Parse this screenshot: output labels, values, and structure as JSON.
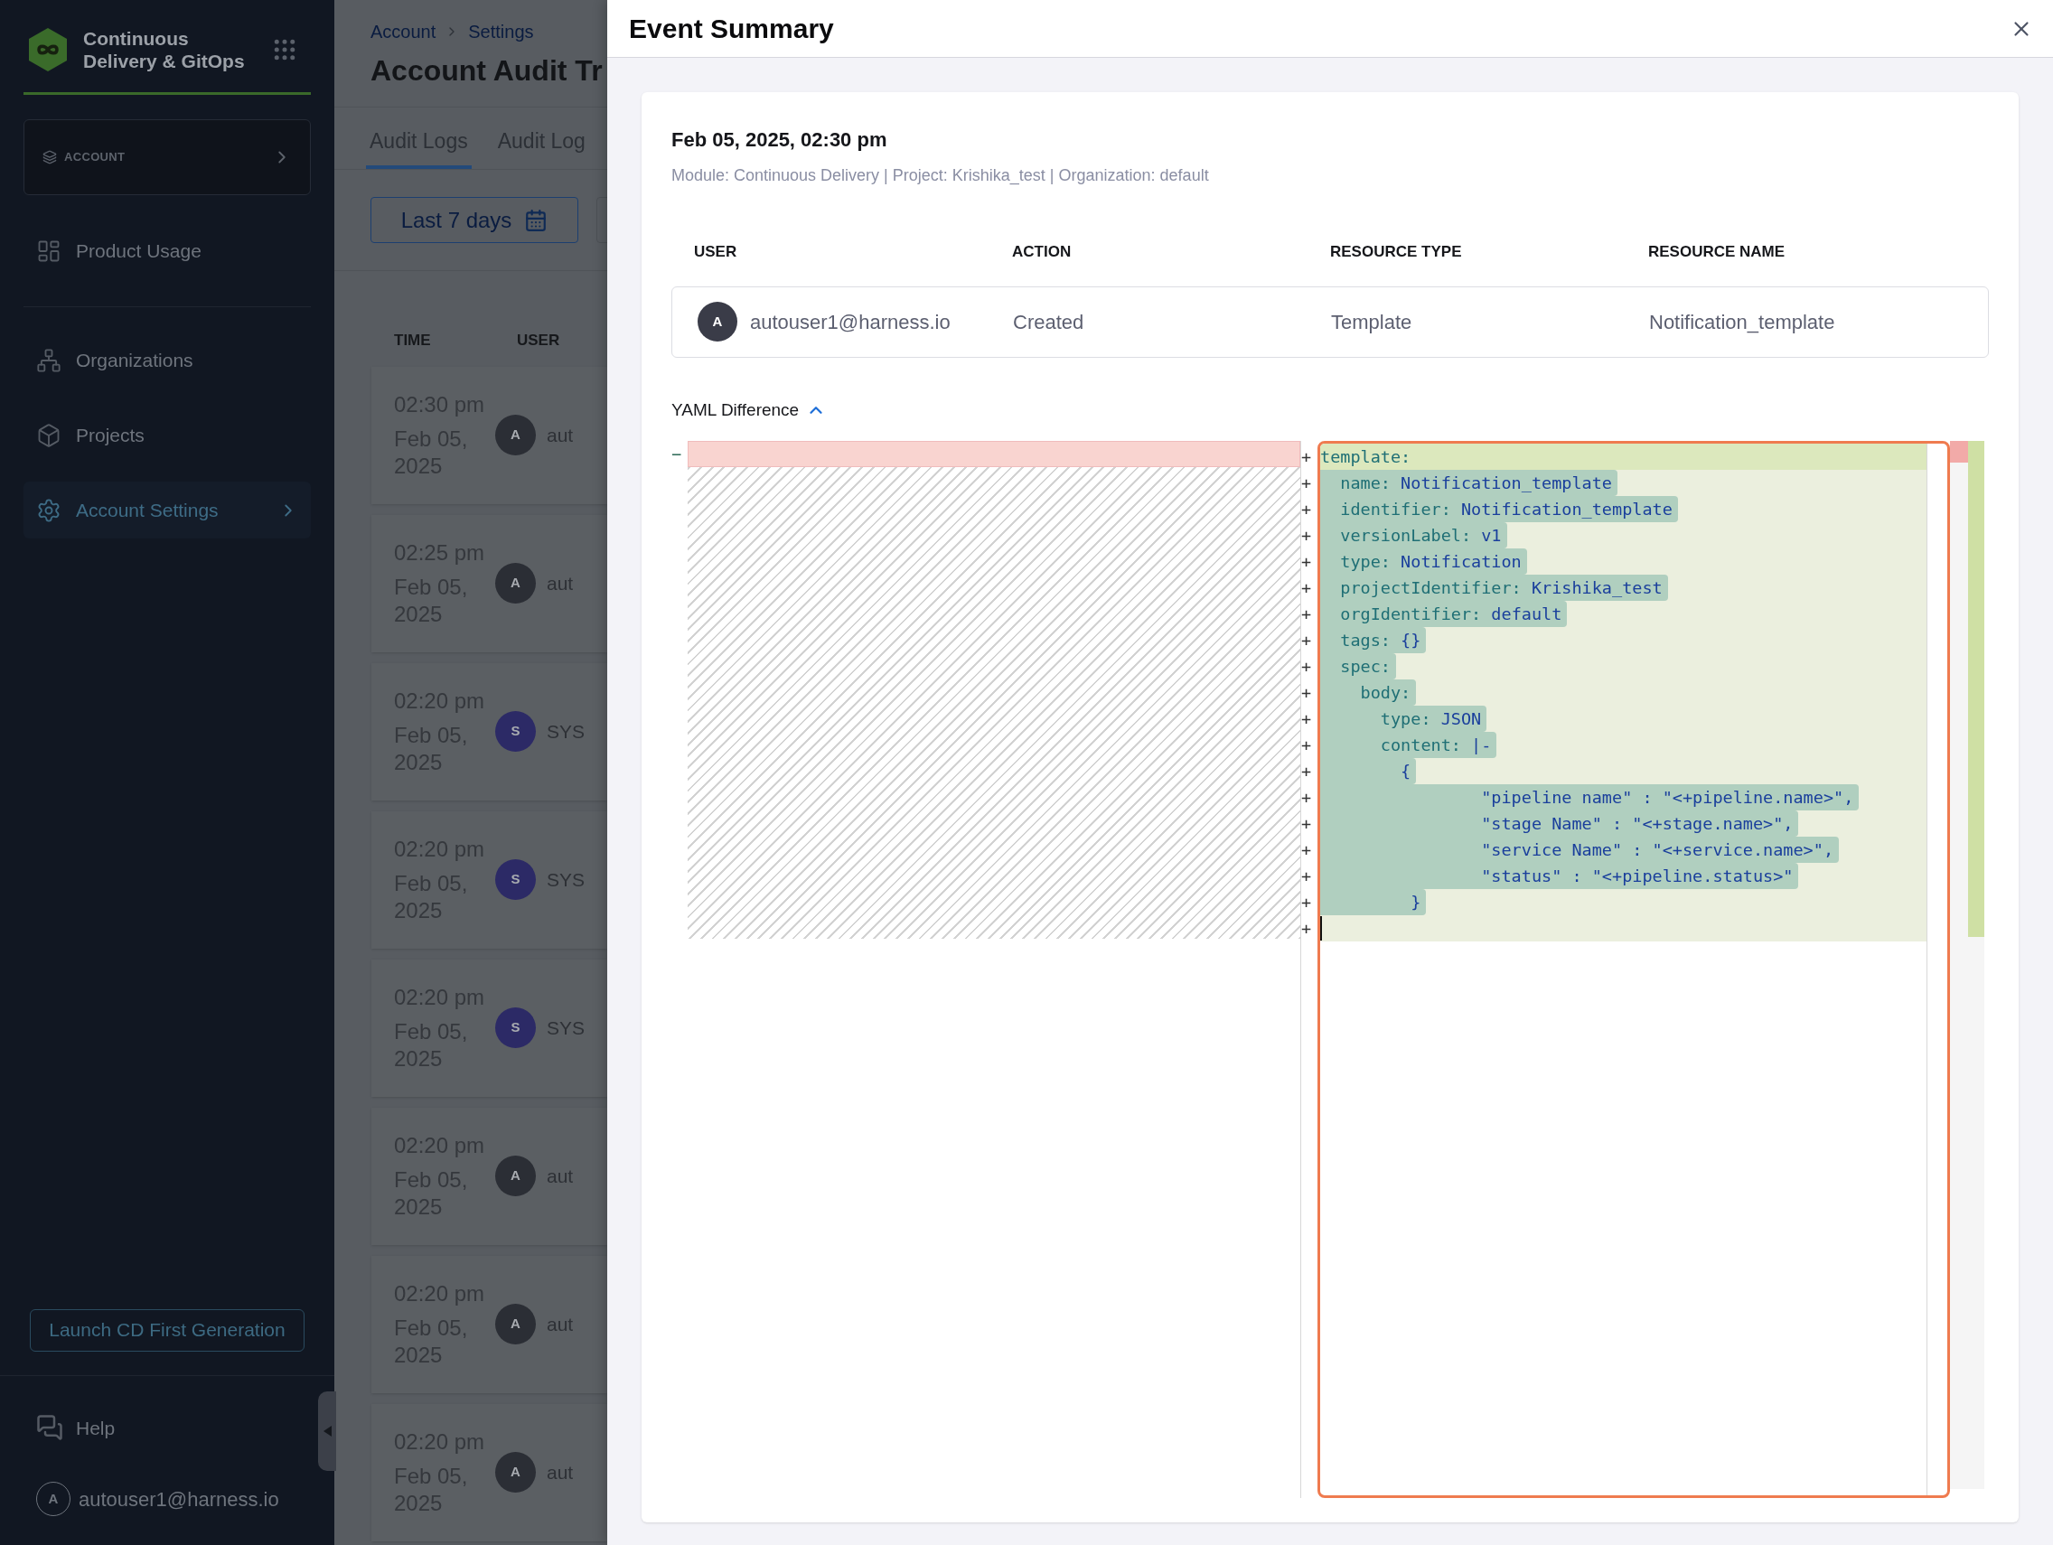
{
  "sidebar": {
    "product_title": "Continuous Delivery & GitOps",
    "scope": "ACCOUNT",
    "nav_groups": [
      [
        {
          "label": "Product Usage",
          "selected": false
        }
      ],
      [
        {
          "label": "Organizations",
          "selected": false
        },
        {
          "label": "Projects",
          "selected": false
        },
        {
          "label": "Account Settings",
          "selected": true
        }
      ]
    ],
    "launch_button": "Launch CD First Generation",
    "help": "Help",
    "user": {
      "initial": "A",
      "email": "autouser1@harness.io"
    }
  },
  "page": {
    "breadcrumbs": [
      "Account",
      "Settings"
    ],
    "title": "Account Audit Tr",
    "tabs": [
      {
        "label": "Audit Logs",
        "selected": true
      },
      {
        "label": "Audit Log",
        "selected": false
      }
    ],
    "date_filter": "Last 7 days",
    "columns": [
      "TIME",
      "USER"
    ],
    "rows": [
      {
        "time": "02:30 pm",
        "date": "Feb 05, 2025",
        "initial": "A",
        "user": "aut",
        "color": "#2b2e35"
      },
      {
        "time": "02:25 pm",
        "date": "Feb 05, 2025",
        "initial": "A",
        "user": "aut",
        "color": "#2b2e35"
      },
      {
        "time": "02:20 pm",
        "date": "Feb 05, 2025",
        "initial": "S",
        "user": "SYS",
        "color": "#2c2a66"
      },
      {
        "time": "02:20 pm",
        "date": "Feb 05, 2025",
        "initial": "S",
        "user": "SYS",
        "color": "#2c2a66"
      },
      {
        "time": "02:20 pm",
        "date": "Feb 05, 2025",
        "initial": "S",
        "user": "SYS",
        "color": "#2c2a66"
      },
      {
        "time": "02:20 pm",
        "date": "Feb 05, 2025",
        "initial": "A",
        "user": "aut",
        "color": "#2b2e35"
      },
      {
        "time": "02:20 pm",
        "date": "Feb 05, 2025",
        "initial": "A",
        "user": "aut",
        "color": "#2b2e35"
      },
      {
        "time": "02:20 pm",
        "date": "Feb 05, 2025",
        "initial": "A",
        "user": "aut",
        "color": "#2b2e35"
      }
    ]
  },
  "drawer": {
    "title": "Event Summary",
    "timestamp": "Feb 05, 2025, 02:30 pm",
    "context": "Module: Continuous Delivery | Project: Krishika_test | Organization: default",
    "columns": [
      "USER",
      "ACTION",
      "RESOURCE TYPE",
      "RESOURCE NAME"
    ],
    "row": {
      "initial": "A",
      "user": "autouser1@harness.io",
      "action": "Created",
      "resource_type": "Template",
      "resource_name": "Notification_template"
    },
    "yaml_section": {
      "title": "YAML Difference",
      "expanded": true
    },
    "diff": {
      "left_lines": [
        {
          "marker": "−",
          "kind": "removed"
        }
      ],
      "right_lines": [
        {
          "marker": "+",
          "key": "template:",
          "first": true
        },
        {
          "marker": "+",
          "key": "  name:",
          "value": " Notification_template"
        },
        {
          "marker": "+",
          "key": "  identifier:",
          "value": " Notification_template"
        },
        {
          "marker": "+",
          "key": "  versionLabel:",
          "value": " v1"
        },
        {
          "marker": "+",
          "key": "  type:",
          "value": " Notification"
        },
        {
          "marker": "+",
          "key": "  projectIdentifier:",
          "value": " Krishika_test"
        },
        {
          "marker": "+",
          "key": "  orgIdentifier:",
          "value": " default"
        },
        {
          "marker": "+",
          "key": "  tags:",
          "value": " {}"
        },
        {
          "marker": "+",
          "key": "  spec:"
        },
        {
          "marker": "+",
          "key": "    body:"
        },
        {
          "marker": "+",
          "key": "      type:",
          "value": " JSON"
        },
        {
          "marker": "+",
          "key": "      content:",
          "value": " |-"
        },
        {
          "marker": "+",
          "value": "        {"
        },
        {
          "marker": "+",
          "value": "                \"pipeline name\" : \"<+pipeline.name>\","
        },
        {
          "marker": "+",
          "value": "                \"stage Name\" : \"<+stage.name>\","
        },
        {
          "marker": "+",
          "value": "                \"service Name\" : \"<+service.name>\","
        },
        {
          "marker": "+",
          "value": "                \"status\" : \"<+pipeline.status>\""
        },
        {
          "marker": "+",
          "value": "         }"
        },
        {
          "marker": "+",
          "cursor": true
        }
      ]
    }
  }
}
